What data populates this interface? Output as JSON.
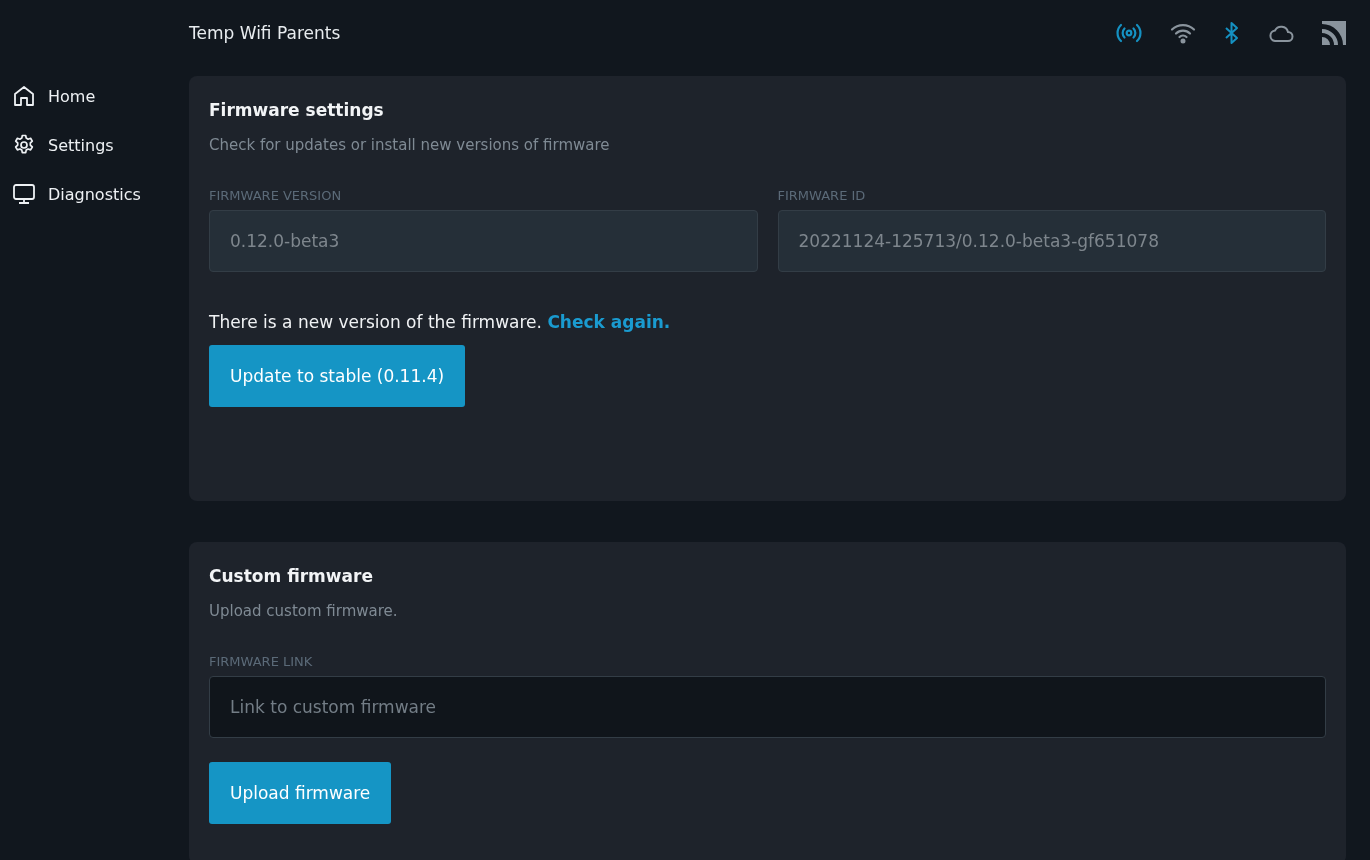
{
  "header": {
    "title": "Temp Wifi Parents"
  },
  "status_icons": [
    {
      "kind": "broadcast",
      "on": true
    },
    {
      "kind": "wifi",
      "on": false
    },
    {
      "kind": "bluetooth",
      "on": true
    },
    {
      "kind": "cloud",
      "on": false
    },
    {
      "kind": "rss",
      "on": false
    }
  ],
  "sidebar": {
    "items": [
      {
        "kind": "home",
        "label": "Home"
      },
      {
        "kind": "settings",
        "label": "Settings"
      },
      {
        "kind": "diagnostics",
        "label": "Diagnostics"
      }
    ]
  },
  "firmware_settings": {
    "title": "Firmware settings",
    "subtitle": "Check for updates or install new versions of firmware",
    "fields": [
      {
        "label": "FIRMWARE VERSION",
        "value": "0.12.0-beta3",
        "disabled": true
      },
      {
        "label": "FIRMWARE ID",
        "value": "20221124-125713/0.12.0-beta3-gf651078",
        "disabled": true
      }
    ],
    "notice": "There is a new version of the firmware.",
    "link": "Check again.",
    "button": "Update to stable (0.11.4)"
  },
  "custom_firmware": {
    "title": "Custom firmware",
    "subtitle": "Upload custom firmware.",
    "field": {
      "label": "FIRMWARE LINK",
      "placeholder": "Link to custom firmware",
      "disabled": false
    },
    "button": "Upload firmware"
  }
}
